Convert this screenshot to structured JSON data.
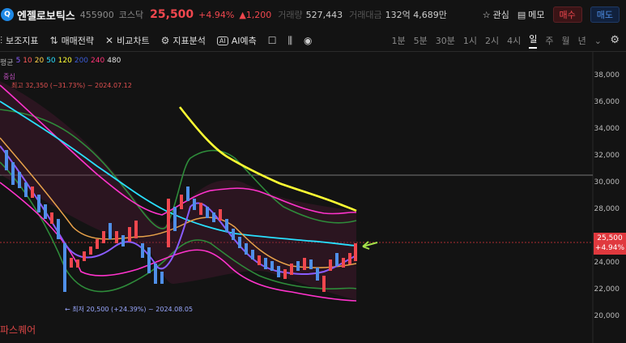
{
  "header": {
    "name": "엔젤로보틱스",
    "code": "455900",
    "market": "코스닥",
    "price": "25,500",
    "change_pct": "+4.94%",
    "change_abs": "▲1,200",
    "volume_label": "거래량",
    "volume": "527,443",
    "amount_label": "거래대금",
    "amount": "132억 4,689만",
    "watch_label": "관심",
    "memo_label": "메모",
    "buy_label": "매수",
    "sell_label": "매도"
  },
  "toolbar": {
    "items": [
      "보조지표",
      "매매전략",
      "비교차트",
      "지표분석",
      "AI예측"
    ],
    "timeframes": [
      "1분",
      "5분",
      "30분",
      "1시",
      "2시",
      "4시",
      "일",
      "주",
      "월",
      "년"
    ],
    "active_timeframe": "일"
  },
  "legend": {
    "prefix": "평균",
    "periods": [
      {
        "label": "5",
        "color": "#8a5cff"
      },
      {
        "label": "10",
        "color": "#ff5a5a"
      },
      {
        "label": "20",
        "color": "#ffd24a"
      },
      {
        "label": "50",
        "color": "#29e0ff"
      },
      {
        "label": "120",
        "color": "#ffff33"
      },
      {
        "label": "200",
        "color": "#3b5bd6"
      },
      {
        "label": "240",
        "color": "#ff3377"
      },
      {
        "label": "480",
        "color": "#e0e0e0"
      }
    ],
    "center_label": "중심"
  },
  "annotations": {
    "high": "최고 32,350 (−31.73%) ~ 2024.07.12",
    "low": "← 최저 20,500 (+24.39%) ~ 2024.08.05"
  },
  "price_axis": {
    "ticks": [
      "38,000",
      "36,000",
      "34,000",
      "32,000",
      "30,000",
      "28,000",
      "26,000",
      "24,000",
      "22,000",
      "20,000"
    ],
    "current_price": "25,500",
    "current_change": "+4.94%"
  },
  "watermark": "파스퀘어",
  "colors": {
    "up": "#f0474e",
    "down": "#4f8fe8",
    "ma5": "#8a5cff",
    "ma20": "#e8a24a",
    "ma50": "#29e0ff",
    "ma120": "#ffff33",
    "bb_inner": "#ff33cc",
    "bb_outer": "#2e8b3a"
  }
}
